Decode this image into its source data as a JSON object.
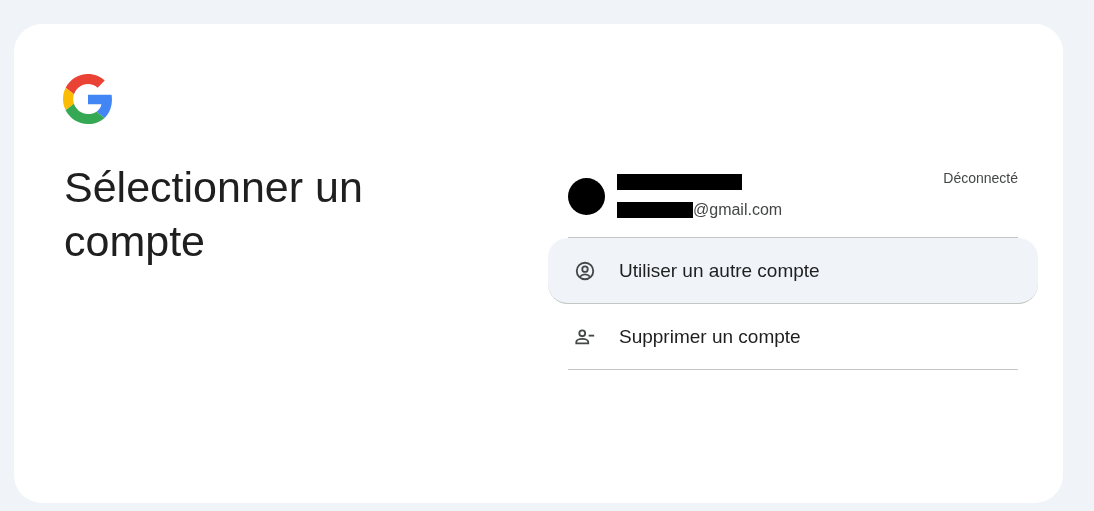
{
  "title": "Sélectionner un compte",
  "account": {
    "email": "@gmail.com",
    "status": "Déconnecté"
  },
  "actions": [
    {
      "kind": "other-account",
      "label": "Utiliser un autre compte",
      "highlighted": true
    },
    {
      "kind": "remove-account",
      "label": "Supprimer un compte",
      "highlighted": false
    }
  ]
}
